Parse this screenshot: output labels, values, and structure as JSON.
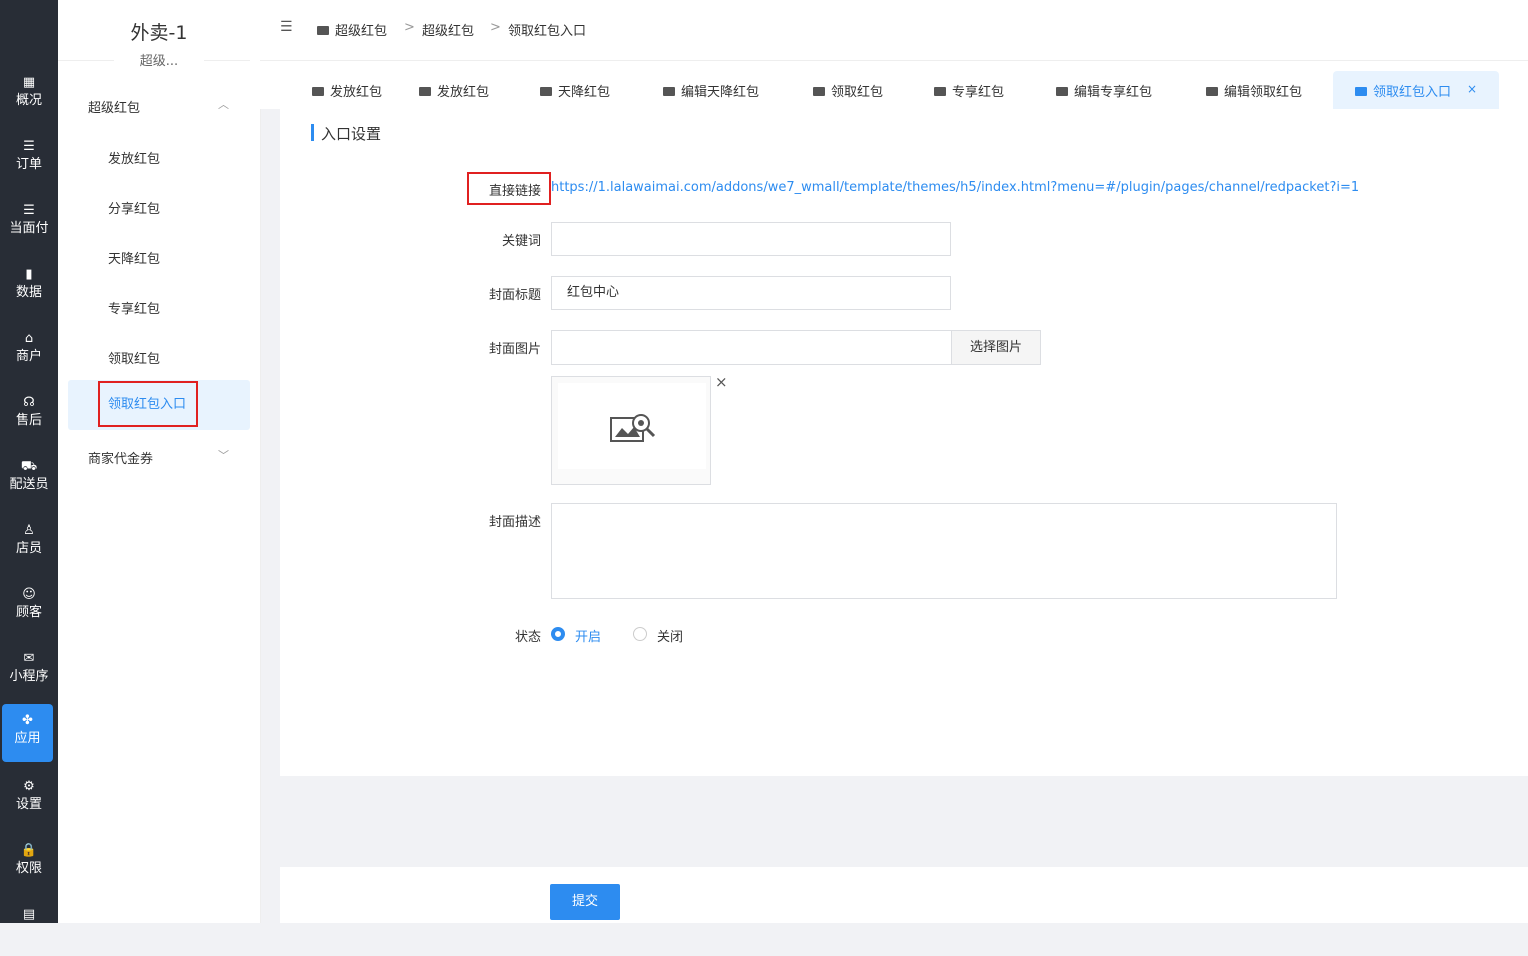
{
  "rail": {
    "items": [
      {
        "label": "概况",
        "icon": "dashboard-icon",
        "glyph": "▦"
      },
      {
        "label": "订单",
        "icon": "list-icon",
        "glyph": "☰"
      },
      {
        "label": "当面付",
        "icon": "list-icon",
        "glyph": "☰"
      },
      {
        "label": "数据",
        "icon": "bar-chart-icon",
        "glyph": "▮"
      },
      {
        "label": "商户",
        "icon": "store-icon",
        "glyph": "⌂"
      },
      {
        "label": "售后",
        "icon": "headset-icon",
        "glyph": "☊"
      },
      {
        "label": "配送员",
        "icon": "scooter-icon",
        "glyph": "⛟"
      },
      {
        "label": "店员",
        "icon": "user-icon",
        "glyph": "♙"
      },
      {
        "label": "顾客",
        "icon": "customer-icon",
        "glyph": "☺"
      },
      {
        "label": "小程序",
        "icon": "wechat-icon",
        "glyph": "✉"
      },
      {
        "label": "应用",
        "icon": "apps-icon",
        "glyph": "✤"
      },
      {
        "label": "设置",
        "icon": "settings-icon",
        "glyph": "⚙"
      },
      {
        "label": "权限",
        "icon": "lock-icon",
        "glyph": "🔒"
      },
      {
        "label": "",
        "icon": "report-icon",
        "glyph": "▤"
      }
    ],
    "active_index": 10,
    "accent": "#2d8cf0"
  },
  "subnav": {
    "shop_name": "外卖-1",
    "shop_sub": "超级...",
    "group1": "超级红包",
    "items": [
      "发放红包",
      "分享红包",
      "天降红包",
      "专享红包",
      "领取红包"
    ],
    "active": "领取红包入口",
    "group2": "商家代金券"
  },
  "breadcrumb": {
    "toggle": "☰",
    "items": [
      "超级红包",
      "超级红包",
      "领取红包入口"
    ],
    "sep": ">"
  },
  "tabs": {
    "items": [
      "发放红包",
      "发放红包",
      "天降红包",
      "编辑天降红包",
      "领取红包",
      "专享红包",
      "编辑专享红包",
      "编辑领取红包"
    ],
    "active": "领取红包入口",
    "close": "×"
  },
  "form": {
    "section_title": "入口设置",
    "link_label": "直接链接",
    "link_url": "https://1.lalawaimai.com/addons/we7_wmall/template/themes/h5/index.html?menu=#/plugin/pages/channel/redpacket?i=1",
    "keyword_label": "关键词",
    "keyword_value": "",
    "cover_title_label": "封面标题",
    "cover_title_value": "红包中心",
    "cover_image_label": "封面图片",
    "cover_image_value": "",
    "pick_image_button": "选择图片",
    "remove_image": "×",
    "cover_desc_label": "封面描述",
    "status_label": "状态",
    "status_on": "开启",
    "status_off": "关闭",
    "status_value": "开启",
    "submit": "提交"
  }
}
